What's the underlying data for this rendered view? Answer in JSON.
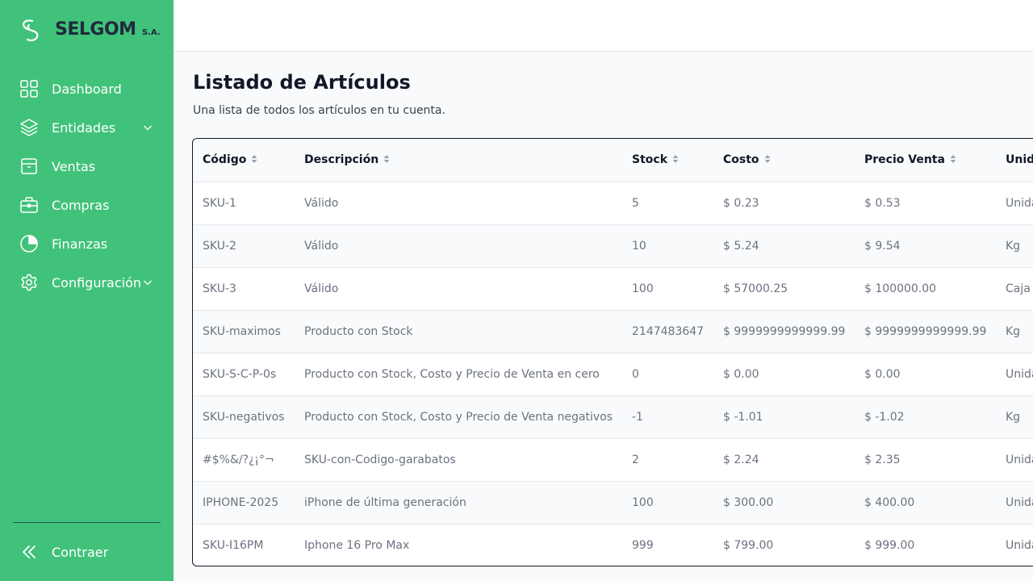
{
  "brand": {
    "name": "SELGOM",
    "suffix": "S.A."
  },
  "sidebar": {
    "items": [
      {
        "label": "Dashboard",
        "icon": "grid-icon"
      },
      {
        "label": "Entidades",
        "icon": "layers-icon",
        "expandable": true
      },
      {
        "label": "Ventas",
        "icon": "archive-box-icon"
      },
      {
        "label": "Compras",
        "icon": "briefcase-icon"
      },
      {
        "label": "Finanzas",
        "icon": "pie-chart-icon"
      },
      {
        "label": "Configuración",
        "icon": "gear-icon",
        "expandable": true
      }
    ],
    "collapse_label": "Contraer",
    "background_color": "#41c27a"
  },
  "page": {
    "title": "Listado de Artículos",
    "subtitle": "Una lista de todos los artículos en tu cuenta."
  },
  "table": {
    "columns": [
      "Código",
      "Descripción",
      "Stock",
      "Costo",
      "Precio Venta",
      "Unid"
    ],
    "rows": [
      [
        "SKU-1",
        "Válido",
        "5",
        "$ 0.23",
        "$ 0.53",
        "Unida"
      ],
      [
        "SKU-2",
        "Válido",
        "10",
        "$ 5.24",
        "$ 9.54",
        "Kg"
      ],
      [
        "SKU-3",
        "Válido",
        "100",
        "$ 57000.25",
        "$ 100000.00",
        "Caja"
      ],
      [
        "SKU-maximos",
        "Producto con Stock",
        "2147483647",
        "$ 9999999999999.99",
        "$ 9999999999999.99",
        "Kg"
      ],
      [
        "SKU-S-C-P-0s",
        "Producto con Stock, Costo y Precio de Venta en cero",
        "0",
        "$ 0.00",
        "$ 0.00",
        "Unida"
      ],
      [
        "SKU-negativos",
        "Producto con Stock, Costo y Precio de Venta negativos",
        "-1",
        "$ -1.01",
        "$ -1.02",
        "Kg"
      ],
      [
        "#$%&/?¿¡°¬",
        "SKU-con-Codigo-garabatos",
        "2",
        "$ 2.24",
        "$ 2.35",
        "Unida"
      ],
      [
        "IPHONE-2025",
        "iPhone de última generación",
        "100",
        "$ 300.00",
        "$ 400.00",
        "Unida"
      ],
      [
        "SKU-I16PM",
        "Iphone 16 Pro Max",
        "999",
        "$ 799.00",
        "$ 999.00",
        "Unida"
      ]
    ]
  }
}
